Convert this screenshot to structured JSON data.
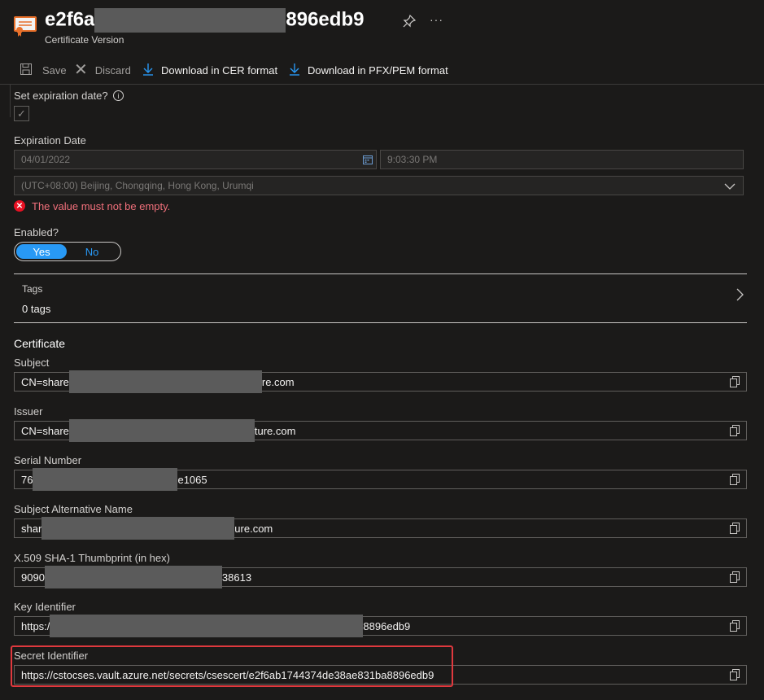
{
  "header": {
    "title_prefix": "e2f6a",
    "title_suffix": "896edb9",
    "subtitle": "Certificate Version",
    "icon": "certificate-icon"
  },
  "commands": {
    "save": "Save",
    "discard": "Discard",
    "download_cer": "Download in CER format",
    "download_pfx": "Download in PFX/PEM format"
  },
  "expiration": {
    "question": "Set expiration date?",
    "date_label": "Expiration Date",
    "date_value": "04/01/2022",
    "time_value": "9:03:30 PM",
    "timezone": "(UTC+08:00) Beijing, Chongqing, Hong Kong, Urumqi",
    "error": "The value must not be empty."
  },
  "enabled": {
    "label": "Enabled?",
    "yes": "Yes",
    "no": "No",
    "selected": "Yes"
  },
  "tags": {
    "label": "Tags",
    "value": "0 tags"
  },
  "certificate": {
    "heading": "Certificate",
    "subject_label": "Subject",
    "subject_pre": "CN=share",
    "subject_post": "re.com",
    "issuer_label": "Issuer",
    "issuer_pre": "CN=share",
    "issuer_post": "ture.com",
    "serial_label": "Serial Number",
    "serial_pre": "76",
    "serial_post": "e1065",
    "san_label": "Subject Alternative Name",
    "san_pre": "shar",
    "san_post": "ure.com",
    "thumb_label": "X.509 SHA-1 Thumbprint (in hex)",
    "thumb_pre": "9090",
    "thumb_post": "38613",
    "key_label": "Key Identifier",
    "key_pre": "https:/",
    "key_post": "8896edb9",
    "secret_label": "Secret Identifier",
    "secret_value": "https://cstocses.vault.azure.net/secrets/csescert/e2f6ab1744374de38ae831ba8896edb9"
  },
  "colors": {
    "accent": "#2899f5",
    "error": "#f1707b",
    "highlight": "#e0393e",
    "background": "#1b1a19"
  }
}
